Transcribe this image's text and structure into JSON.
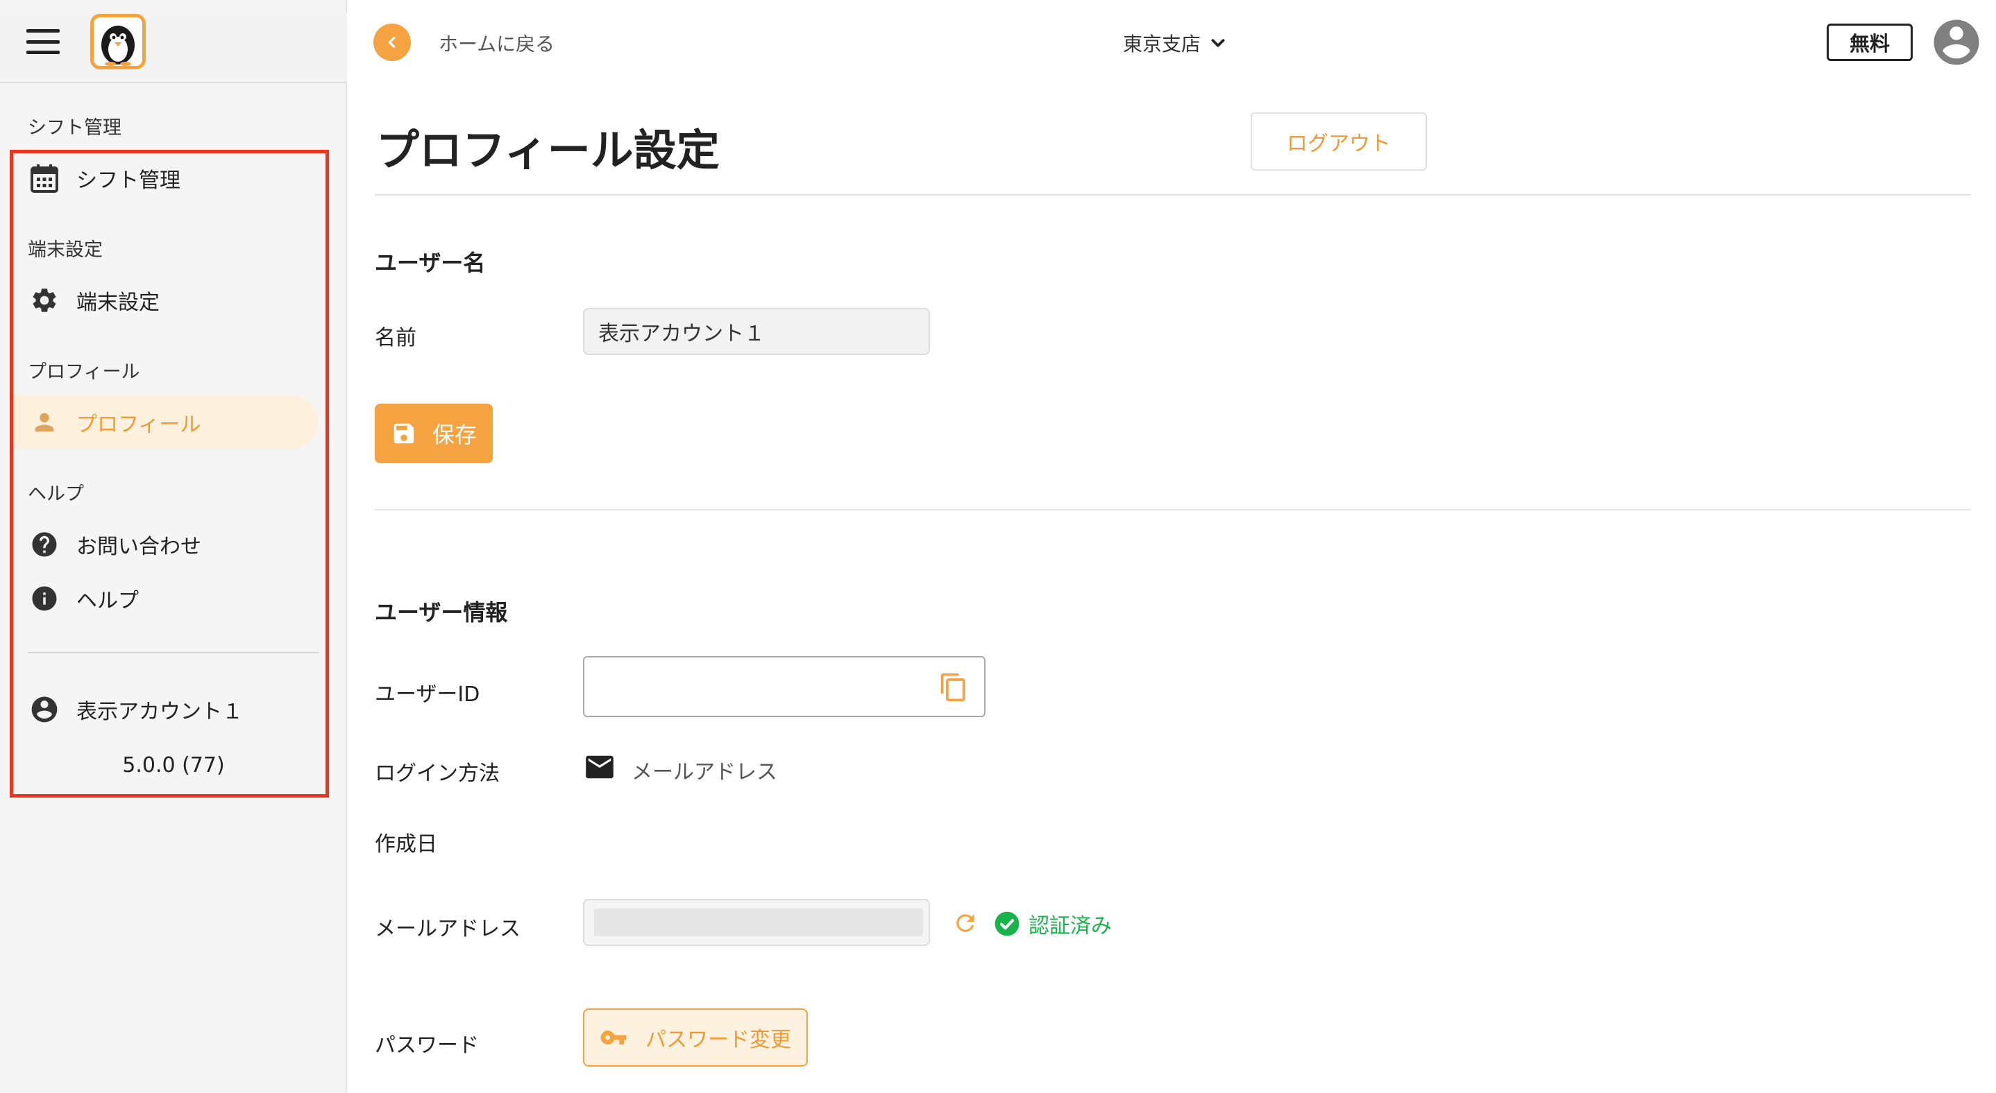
{
  "sidebar": {
    "sections": [
      {
        "label": "シフト管理",
        "item": {
          "label": "シフト管理",
          "icon": "calendar-icon"
        }
      },
      {
        "label": "端末設定",
        "item": {
          "label": "端末設定",
          "icon": "gear-icon"
        }
      },
      {
        "label": "プロフィール",
        "item": {
          "label": "プロフィール",
          "icon": "person-icon",
          "active": true
        }
      },
      {
        "label": "ヘルプ",
        "items": [
          {
            "label": "お問い合わせ",
            "icon": "help-circle-icon"
          },
          {
            "label": "ヘルプ",
            "icon": "info-icon"
          }
        ]
      }
    ],
    "account": {
      "label": "表示アカウント１",
      "icon": "account-circle-icon"
    },
    "version": "5.0.0 (77)"
  },
  "header": {
    "back_label": "ホームに戻る",
    "branch": "東京支店",
    "plan": "無料"
  },
  "main": {
    "title": "プロフィール設定",
    "logout_label": "ログアウト",
    "username_section": {
      "title": "ユーザー名",
      "name_label": "名前",
      "name_value": "表示アカウント１",
      "save_label": "保存"
    },
    "userinfo_section": {
      "title": "ユーザー情報",
      "userid_label": "ユーザーID",
      "userid_value": "",
      "login_method_label": "ログイン方法",
      "login_method_value": "メールアドレス",
      "created_label": "作成日",
      "email_label": "メールアドレス",
      "verified_label": "認証済み",
      "password_label": "パスワード",
      "password_button": "パスワード変更"
    }
  },
  "colors": {
    "accent": "#f4a340",
    "accent_text": "#f09a35",
    "active_bg": "#fdf0dc",
    "verified": "#18b44a",
    "highlight": "#e8361f"
  }
}
